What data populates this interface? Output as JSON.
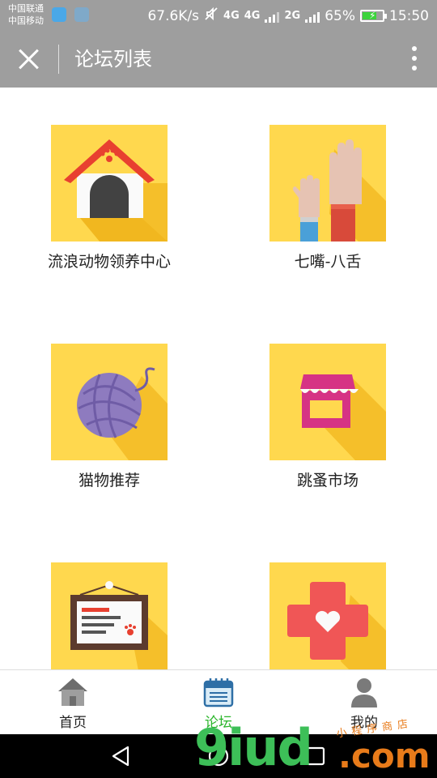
{
  "status_bar": {
    "carrier_1": "中国联通",
    "carrier_2": "中国移动",
    "speed": "67.6K/s",
    "network_1": "4G",
    "network_2": "4G",
    "network_3": "2G",
    "battery": "65%",
    "time": "15:50"
  },
  "app_bar": {
    "title": "论坛列表"
  },
  "forums": [
    {
      "label": "流浪动物领养中心",
      "icon": "dog-house-icon"
    },
    {
      "label": "七嘴-八舌",
      "icon": "raised-hands-icon"
    },
    {
      "label": "猫物推荐",
      "icon": "yarn-ball-icon"
    },
    {
      "label": "跳蚤市场",
      "icon": "shop-icon"
    },
    {
      "label": "",
      "icon": "certificate-board-icon"
    },
    {
      "label": "",
      "icon": "medical-cross-icon"
    }
  ],
  "tabs": [
    {
      "label": "首页",
      "icon": "home-icon",
      "active": false
    },
    {
      "label": "论坛",
      "icon": "notepad-icon",
      "active": true
    },
    {
      "label": "我的",
      "icon": "user-icon",
      "active": false
    }
  ],
  "watermark": {
    "logo": "9iud",
    "domain": ".com",
    "tagline": "小程序商店"
  },
  "colors": {
    "bar_gray": "#9e9e9e",
    "tile_yellow": "#ffd84e",
    "active_green": "#2bb52b"
  }
}
